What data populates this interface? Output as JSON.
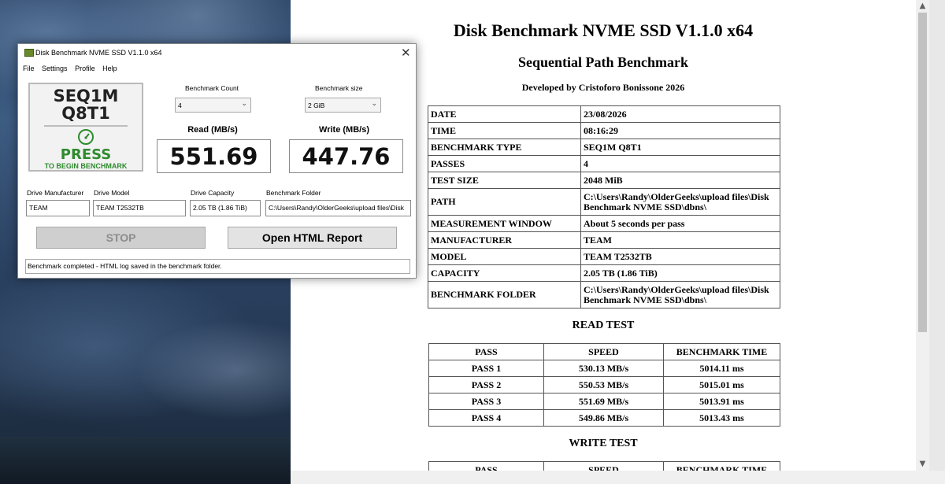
{
  "app": {
    "title": "Disk Benchmark NVME SSD V1.1.0 x64",
    "menu": [
      "File",
      "Settings",
      "Profile",
      "Help"
    ],
    "test_name_line1": "SEQ1M",
    "test_name_line2": "Q8T1",
    "press_label": "PRESS",
    "press_sub": "TO BEGIN BENCHMARK",
    "benchmark_count_label": "Benchmark Count",
    "benchmark_count_value": "4",
    "benchmark_size_label": "Benchmark size",
    "benchmark_size_value": "2 GiB",
    "read_label": "Read (MB/s)",
    "read_value": "551.69",
    "write_label": "Write (MB/s)",
    "write_value": "447.76",
    "drive_manufacturer_label": "Drive Manufacturer",
    "drive_manufacturer_value": "TEAM",
    "drive_model_label": "Drive Model",
    "drive_model_value": "TEAM T2532TB",
    "drive_capacity_label": "Drive Capacity",
    "drive_capacity_value": "2.05 TB (1.86 TiB)",
    "benchmark_folder_label": "Benchmark Folder",
    "benchmark_folder_value": "C:\\Users\\Randy\\OlderGeeks\\upload files\\Disk",
    "stop_label": "STOP",
    "open_report_label": "Open HTML Report",
    "status_text": "Benchmark completed - HTML log saved in the benchmark folder."
  },
  "report": {
    "title": "Disk Benchmark NVME SSD V1.1.0 x64",
    "subtitle": "Sequential Path Benchmark",
    "developer": "Developed by Cristoforo Bonissone 2026",
    "info": [
      {
        "key": "DATE",
        "value": "23/08/2026"
      },
      {
        "key": "TIME",
        "value": "08:16:29"
      },
      {
        "key": "BENCHMARK TYPE",
        "value": "SEQ1M Q8T1"
      },
      {
        "key": "PASSES",
        "value": "4"
      },
      {
        "key": "TEST SIZE",
        "value": "2048 MiB"
      },
      {
        "key": "PATH",
        "value": "C:\\Users\\Randy\\OlderGeeks\\upload files\\Disk Benchmark NVME SSD\\dbns\\"
      },
      {
        "key": "MEASUREMENT WINDOW",
        "value": "About 5 seconds per pass"
      },
      {
        "key": "MANUFACTURER",
        "value": "TEAM"
      },
      {
        "key": "MODEL",
        "value": "TEAM T2532TB"
      },
      {
        "key": "CAPACITY",
        "value": "2.05 TB (1.86 TiB)"
      },
      {
        "key": "BENCHMARK FOLDER",
        "value": "C:\\Users\\Randy\\OlderGeeks\\upload files\\Disk Benchmark NVME SSD\\dbns\\"
      }
    ],
    "read_title": "READ TEST",
    "write_title": "WRITE TEST",
    "headers": [
      "PASS",
      "SPEED",
      "BENCHMARK TIME"
    ],
    "read_rows": [
      [
        "PASS 1",
        "530.13 MB/s",
        "5014.11 ms"
      ],
      [
        "PASS 2",
        "550.53 MB/s",
        "5015.01 ms"
      ],
      [
        "PASS 3",
        "551.69 MB/s",
        "5013.91 ms"
      ],
      [
        "PASS 4",
        "549.86 MB/s",
        "5013.43 ms"
      ]
    ]
  }
}
